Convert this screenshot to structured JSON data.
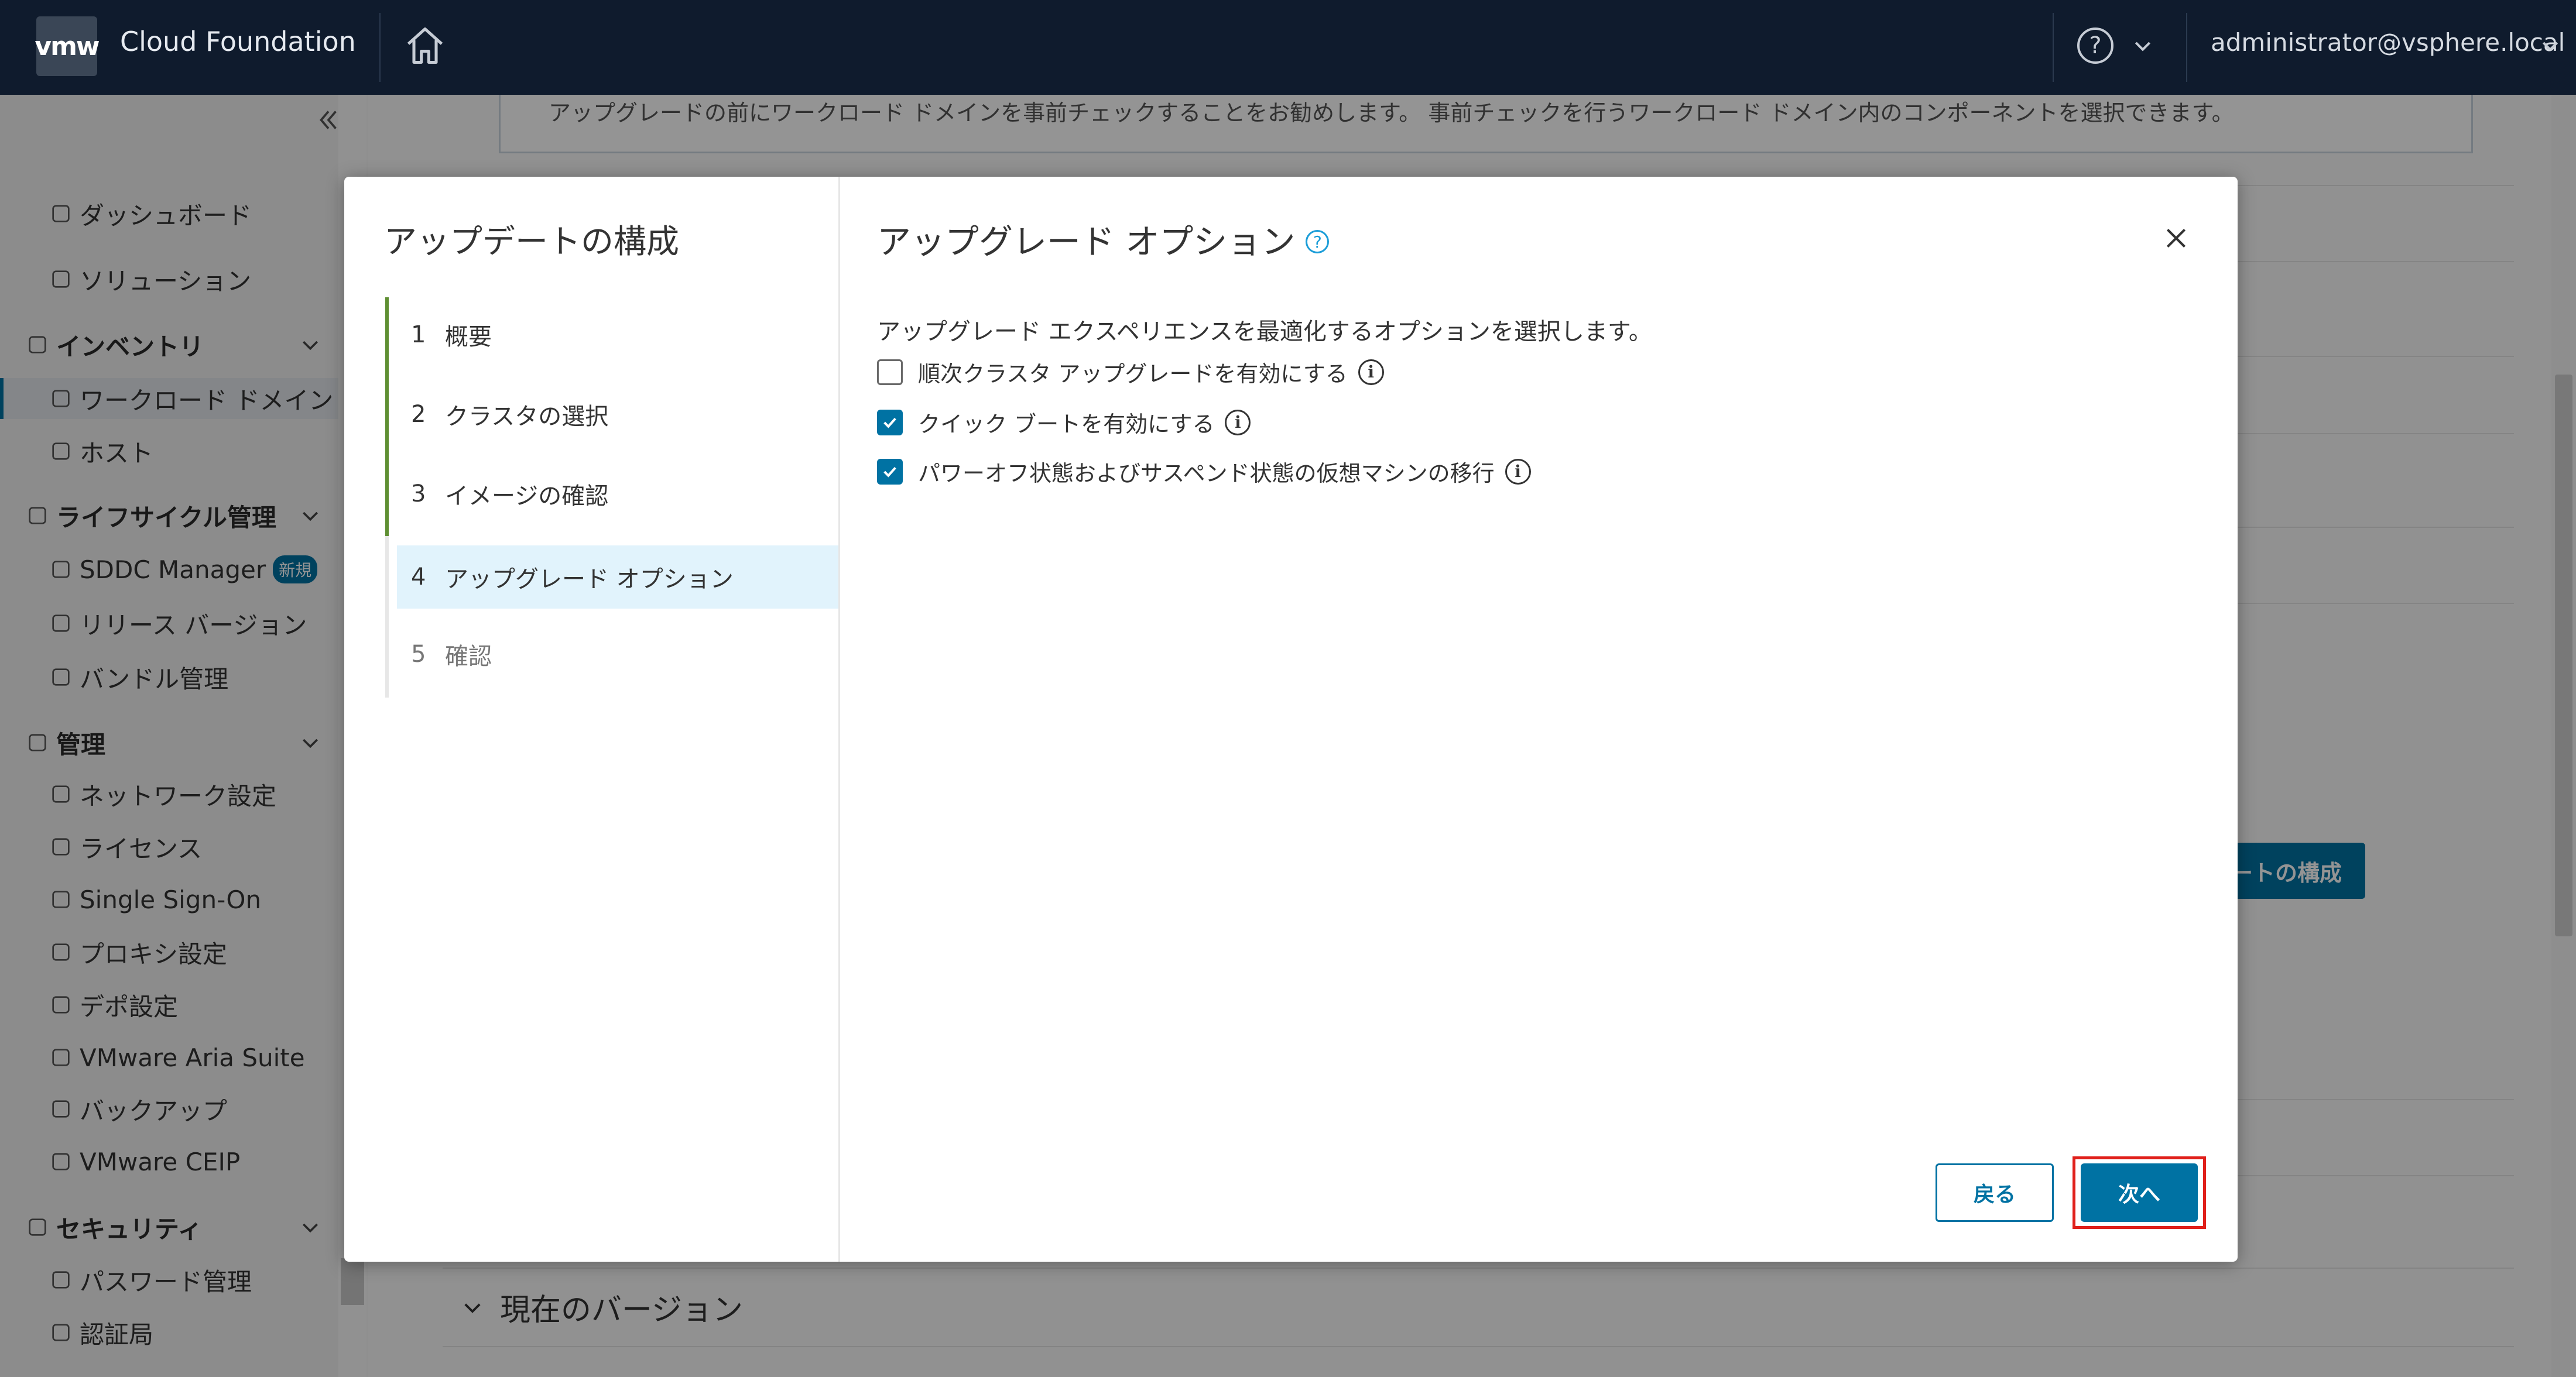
{
  "header": {
    "logo": "vmw",
    "title": "Cloud Foundation",
    "user": "administrator@vsphere.local"
  },
  "sidebar": {
    "items": [
      {
        "label": "ダッシュボード",
        "icon": "dashboard-icon"
      },
      {
        "label": "ソリューション",
        "icon": "solutions-icon"
      },
      {
        "label": "インベントリ",
        "icon": "inventory-icon",
        "section": true
      },
      {
        "label": "ワークロード ドメイン",
        "icon": "workload-domain-icon",
        "active": true
      },
      {
        "label": "ホスト",
        "icon": "host-icon"
      },
      {
        "label": "ライフサイクル管理",
        "icon": "lifecycle-icon",
        "section": true
      },
      {
        "label": "SDDC Manager",
        "icon": "sddc-icon",
        "badge": "新規"
      },
      {
        "label": "リリース バージョン",
        "icon": "release-icon"
      },
      {
        "label": "バンドル管理",
        "icon": "bundle-icon"
      },
      {
        "label": "管理",
        "icon": "admin-gear-icon",
        "section": true
      },
      {
        "label": "ネットワーク設定",
        "icon": "network-icon"
      },
      {
        "label": "ライセンス",
        "icon": "license-icon"
      },
      {
        "label": "Single Sign-On",
        "icon": "sso-icon"
      },
      {
        "label": "プロキシ設定",
        "icon": "proxy-icon"
      },
      {
        "label": "デポ設定",
        "icon": "depot-icon"
      },
      {
        "label": "VMware Aria Suite",
        "icon": "aria-icon"
      },
      {
        "label": "バックアップ",
        "icon": "backup-icon"
      },
      {
        "label": "VMware CEIP",
        "icon": "ceip-icon"
      },
      {
        "label": "セキュリティ",
        "icon": "security-icon",
        "section": true
      },
      {
        "label": "パスワード管理",
        "icon": "password-icon"
      },
      {
        "label": "認証局",
        "icon": "certificate-icon"
      }
    ]
  },
  "background": {
    "info_text": "アップグレードの前にワークロード ドメインを事前チェックすることをお勧めします。 事前チェックを行うワークロード ドメイン内のコンポーネントを選択できます。",
    "partial_button": "ートの構成",
    "current_version": "現在のバージョン"
  },
  "wizard": {
    "title": "アップデートの構成",
    "steps": [
      {
        "num": "1",
        "label": "概要",
        "state": "done"
      },
      {
        "num": "2",
        "label": "クラスタの選択",
        "state": "done"
      },
      {
        "num": "3",
        "label": "イメージの確認",
        "state": "done"
      },
      {
        "num": "4",
        "label": "アップグレード オプション",
        "state": "current"
      },
      {
        "num": "5",
        "label": "確認",
        "state": "pending"
      }
    ],
    "page_title": "アップグレード オプション",
    "help_glyph": "?",
    "description": "アップグレード エクスペリエンスを最適化するオプションを選択します。",
    "options": [
      {
        "label": "順次クラスタ アップグレードを有効にする",
        "checked": false
      },
      {
        "label": "クイック ブートを有効にする",
        "checked": true
      },
      {
        "label": "パワーオフ状態およびサスペンド状態の仮想マシンの移行",
        "checked": true
      }
    ],
    "info_glyph": "i",
    "back_label": "戻る",
    "next_label": "次へ"
  },
  "colors": {
    "header_bg": "#0f1b2d",
    "accent": "#0072a3",
    "step_done": "#5e8f32",
    "highlight": "#e0201b"
  }
}
